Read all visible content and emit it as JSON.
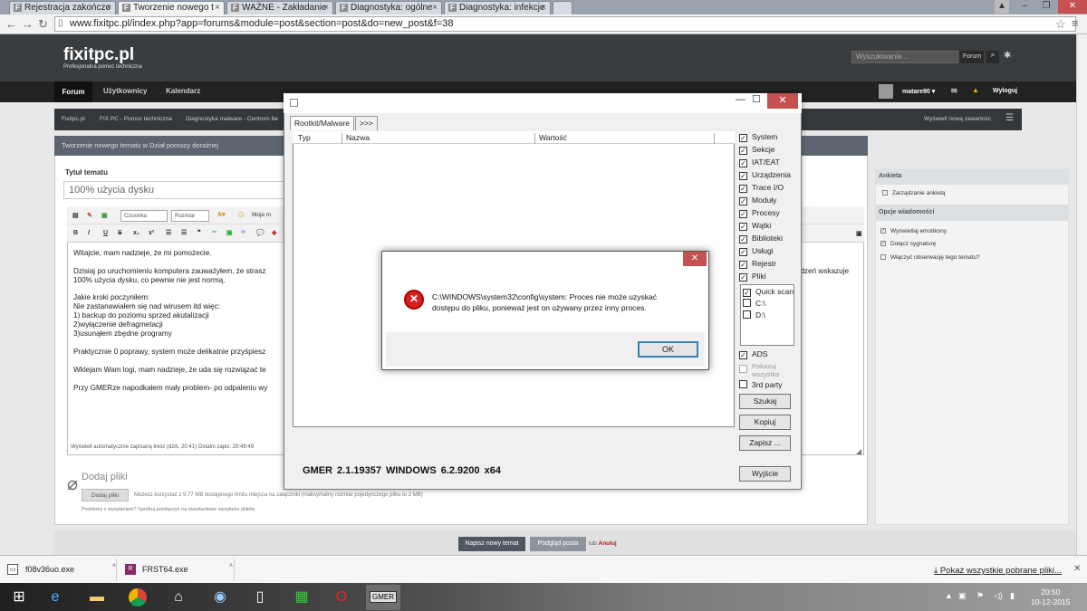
{
  "browser": {
    "tabs": [
      {
        "label": "Rejestracja zakończo"
      },
      {
        "label": "Tworzenie nowego t"
      },
      {
        "label": "WAŻNE - Zakładanie"
      },
      {
        "label": "Diagnostyka: ogólne"
      },
      {
        "label": "Diagnostyka: infekcje"
      }
    ],
    "url": "www.fixitpc.pl/index.php?app=forums&module=post&section=post&do=new_post&f=38"
  },
  "site": {
    "logo": "fixitpc.pl",
    "logo_sub": "Profesjonalna pomoc techniczna",
    "search_placeholder": "Wyszukiwanie...",
    "search_scope": "Forum",
    "nav": [
      "Forum",
      "Użytkownicy",
      "Kalendarz"
    ],
    "user": "matare90",
    "logout": "Wyloguj",
    "breadcrumbs": [
      "Fixitpc.pl",
      "FIX PC - Pomoc techniczna",
      "Diagnostyka malware - Centrum be"
    ],
    "new_content": "Wyświetl nową zawartość",
    "panel_title": "Tworzenie nowego tematu w Dział pomocy doraźnej",
    "topic_title_label": "Tytuł tematu",
    "topic_title_value": "100% użycia dysku",
    "font_select": "Czcionka",
    "size_select": "Rozmiar",
    "my_media": "Moje m",
    "editor_lines": [
      "Witajcie, mam nadzieje, że mi pomożecie.",
      "Dzisiaj po uruchomieniu komputera zauważyłem, że strasz",
      "100% użycia dysku, co pewnie nie jest normą.",
      "Jakie kroki poczyniłem:",
      "Nie zastanawiałem się nad wirusem itd więc:",
      "1) backup do poziomu sprzed akutalizacji",
      "2)wyłączenie defragmetacji",
      "3)usunąłem zbędne programy",
      "Praktycznie 0 poprawy, system może delikatnie przyśpiesz",
      "Wklejam Wam logi, mam nadzieje, że uda się rozwiązać te",
      "Przy GMERze napodkałem mały problem- po odpaleniu wy"
    ],
    "editor_right_fragment": "rządzeń wskazuje",
    "autosave": "Wyświetl automatycznie zapisaną treść (dziś, 20:41)  Ostatni zapis: 20:49:49",
    "attach_title": "Dodaj pliki",
    "attach_button": "Dodaj pliki",
    "attach_info": "Możesz korzystać z 9.77 MB dostępnego limitu miejsca na załączniki (maksymalny rozmiar pojedynczego pliku to 2 MB)",
    "attach_problem": "Problemy z wysyłaniem? Spróbuj przełączyć na standardowe wysyłanie plików",
    "submit": "Napisz nowy temat",
    "preview": "Podgląd posta",
    "or": "lub",
    "cancel": "Anuluj",
    "sidebar": {
      "poll_head": "Ankieta",
      "poll_item": "Zarządzanie ankietą",
      "opts_head": "Opcje wiadomości",
      "opts": [
        "Wyświetlaj emotikony",
        "Dołącz sygnaturę",
        "Włączyć obserwację tego tematu?"
      ]
    }
  },
  "gmer": {
    "tabs": [
      "Rootkit/Malware",
      ">>>"
    ],
    "columns": [
      "Typ",
      "Nazwa",
      "Wartość"
    ],
    "checks": [
      "System",
      "Sekcje",
      "IAT/EAT",
      "Urządzenia",
      "Trace I/O",
      "Moduły",
      "Procesy",
      "Wątki",
      "Biblioteki",
      "Usługi",
      "Rejestr",
      "Pliki"
    ],
    "drives": [
      "Quick scan",
      "C:\\",
      "D:\\"
    ],
    "ads": "ADS",
    "show_all": "Pokazuj wszystko",
    "third_party": "3rd party",
    "btn_scan": "Szukaj",
    "btn_copy": "Kopiuj",
    "btn_save": "Zapisz ...",
    "btn_exit": "Wyjście",
    "status": "GMER 2.1.19357   WINDOWS 6.2.9200  x64"
  },
  "error": {
    "line1": "C:\\WINDOWS\\system32\\config\\system: Proces nie może uzyskać",
    "line2": "dostępu do pliku, ponieważ jest on używany przez inny proces.",
    "ok": "OK"
  },
  "downloads": {
    "items": [
      "f08v36uo.exe",
      "FRST64.exe"
    ],
    "show_all": "Pokaż wszystkie pobrane pliki..."
  },
  "clock": {
    "time": "20:50",
    "date": "10-12-2015"
  }
}
